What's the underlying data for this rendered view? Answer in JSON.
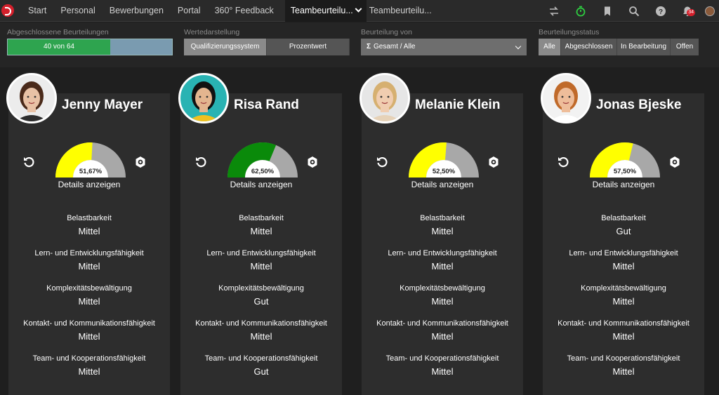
{
  "nav": {
    "items": [
      "Start",
      "Personal",
      "Bewerbungen",
      "Portal",
      "360° Feedback"
    ],
    "active_tab": "Teambeurteilu...",
    "next_tab": "Teambeurteilu...",
    "notification_count": "34",
    "icons": [
      "swap-icon",
      "stopwatch-icon",
      "bookmark-icon",
      "search-icon",
      "help-icon",
      "bell-icon",
      "user-avatar"
    ],
    "stopwatch_color": "#2ecc40"
  },
  "filters": {
    "progress_label": "Abgeschlossene Beurteilungen",
    "progress_text": "40 von 64",
    "progress_fraction": 0.625,
    "display_label": "Wertedarstellung",
    "display_options": [
      "Qualifizierungssystem",
      "Prozentwert"
    ],
    "display_selected": "Qualifizierungssystem",
    "assessment_label": "Beurteilung von",
    "assessment_value": "Gesamt / Alle",
    "status_label": "Beurteilungsstatus",
    "status_options": [
      "Alle",
      "Abgeschlossen",
      "In Bearbeitung",
      "Offen"
    ],
    "status_selected": "Alle"
  },
  "details_label": "Details anzeigen",
  "criteria_labels": [
    "Belastbarkeit",
    "Lern- und Entwicklungsfähigkeit",
    "Komplexitätsbewältigung",
    "Kontakt- und Kommunikationsfähigkeit",
    "Team- und Kooperationsfähigkeit"
  ],
  "people": [
    {
      "name": "Jenny Mayer",
      "percent_text": "51,67%",
      "percent": 51.67,
      "color": "#ffff00",
      "values": [
        "Mittel",
        "Mittel",
        "Mittel",
        "Mittel",
        "Mittel"
      ]
    },
    {
      "name": "Risa Rand",
      "percent_text": "62,50%",
      "percent": 62.5,
      "color": "#0a8a0a",
      "values": [
        "Mittel",
        "Mittel",
        "Gut",
        "Mittel",
        "Gut"
      ]
    },
    {
      "name": "Melanie Klein",
      "percent_text": "52,50%",
      "percent": 52.5,
      "color": "#ffff00",
      "values": [
        "Mittel",
        "Mittel",
        "Mittel",
        "Mittel",
        "Mittel"
      ]
    },
    {
      "name": "Jonas Bjeske",
      "percent_text": "57,50%",
      "percent": 57.5,
      "color": "#ffff00",
      "values": [
        "Gut",
        "Mittel",
        "Mittel",
        "Mittel",
        "Mittel"
      ]
    }
  ]
}
